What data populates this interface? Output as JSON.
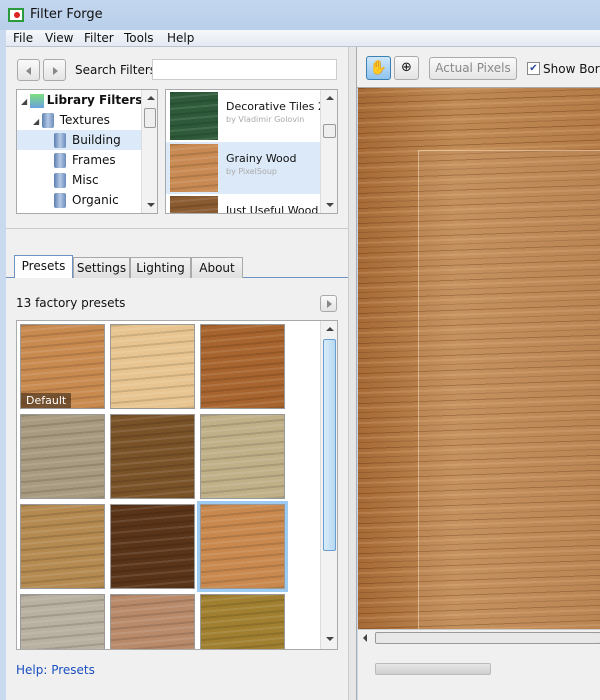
{
  "window": {
    "title": "Filter Forge"
  },
  "menu": [
    "File",
    "View",
    "Filter",
    "Tools",
    "Help"
  ],
  "search": {
    "label": "Search Filters:",
    "value": ""
  },
  "tree": {
    "root": "Library Filters",
    "category": "Textures",
    "items": [
      "Building",
      "Frames",
      "Misc",
      "Organic"
    ],
    "selected": "Building"
  },
  "filters": [
    {
      "name": "Decorative Tiles 2",
      "author": "by Vladimir Golovin",
      "color": "#2e5a3a"
    },
    {
      "name": "Grainy Wood",
      "author": "by PixelSoup",
      "color": "#c88a52"
    },
    {
      "name": "Just Useful Wood",
      "author": "",
      "color": "#8a5a30"
    }
  ],
  "tabs": [
    "Presets",
    "Settings",
    "Lighting",
    "About"
  ],
  "active_tab": "Presets",
  "presets": {
    "count_label": "13 factory presets",
    "default_label": "Default",
    "colors": [
      "#c98a50",
      "#e8c590",
      "#a8642e",
      "#a89a80",
      "#7a5228",
      "#c0b088",
      "#b48a50",
      "#5a3418",
      "#c8884e",
      "#b8b0a0",
      "#b88a6a",
      "#a08030"
    ],
    "selected_index": 8
  },
  "help_link": "Help: Presets",
  "toolbar": {
    "actual_pixels": "Actual Pixels",
    "show_border": "Show Bord",
    "show_border_checked": true,
    "hand_active": true
  }
}
